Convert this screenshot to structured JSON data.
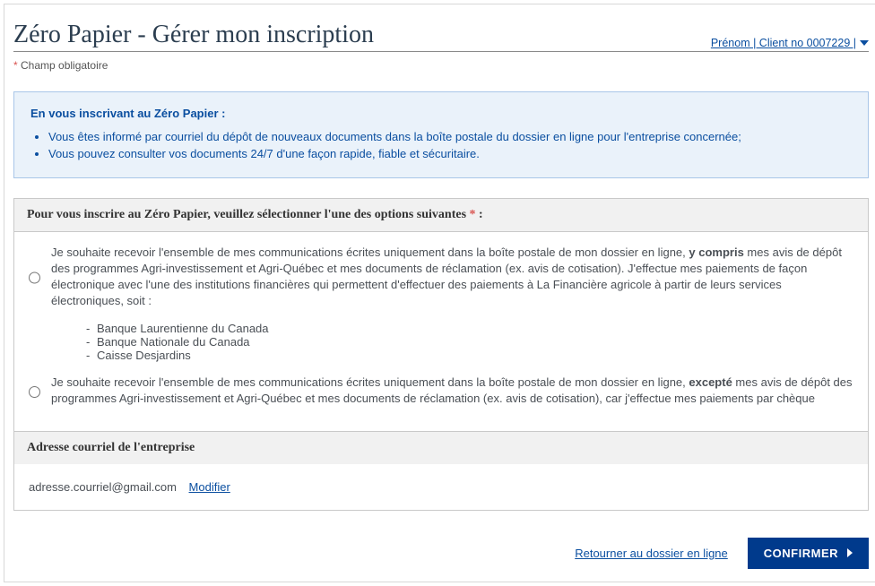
{
  "header": {
    "title": "Zéro Papier - Gérer mon inscription",
    "user_link": "Prénom | Client no 0007229 |"
  },
  "required_note": "Champ obligatoire",
  "info": {
    "title": "En vous inscrivant au Zéro Papier :",
    "bullets": [
      "Vous êtes informé par courriel du dépôt de nouveaux documents dans la boîte postale du dossier en ligne pour l'entreprise concernée;",
      "Vous pouvez consulter vos documents 24/7 d'une façon rapide, fiable et sécuritaire."
    ]
  },
  "form": {
    "legend": "Pour vous inscrire au Zéro Papier, veuillez sélectionner l'une des options suivantes",
    "option1_pre": "Je souhaite recevoir l'ensemble de mes communications écrites uniquement dans la boîte postale de mon dossier en ligne, ",
    "option1_bold": "y compris",
    "option1_post": " mes avis de dépôt des programmes Agri-investissement et Agri-Québec et mes documents de réclamation (ex. avis de cotisation). J'effectue mes paiements de façon électronique avec l'une des institutions financières qui permettent d'effectuer des paiements à La Financière agricole à partir de leurs services électroniques, soit :",
    "banks": [
      "Banque Laurentienne du Canada",
      "Banque Nationale du Canada",
      "Caisse Desjardins"
    ],
    "option2_pre": "Je souhaite recevoir l'ensemble de mes communications écrites uniquement dans la boîte postale de mon dossier en ligne, ",
    "option2_bold": "excepté",
    "option2_post": " mes avis de dépôt des programmes Agri-investissement et Agri-Québec et mes documents de réclamation (ex. avis de cotisation), car j'effectue mes paiements par chèque",
    "email_section_title": "Adresse courriel de l'entreprise",
    "email_value": "adresse.courriel@gmail.com",
    "modify_label": "Modifier"
  },
  "actions": {
    "return_link": "Retourner au dossier en ligne",
    "confirm_label": "CONFIRMER"
  }
}
